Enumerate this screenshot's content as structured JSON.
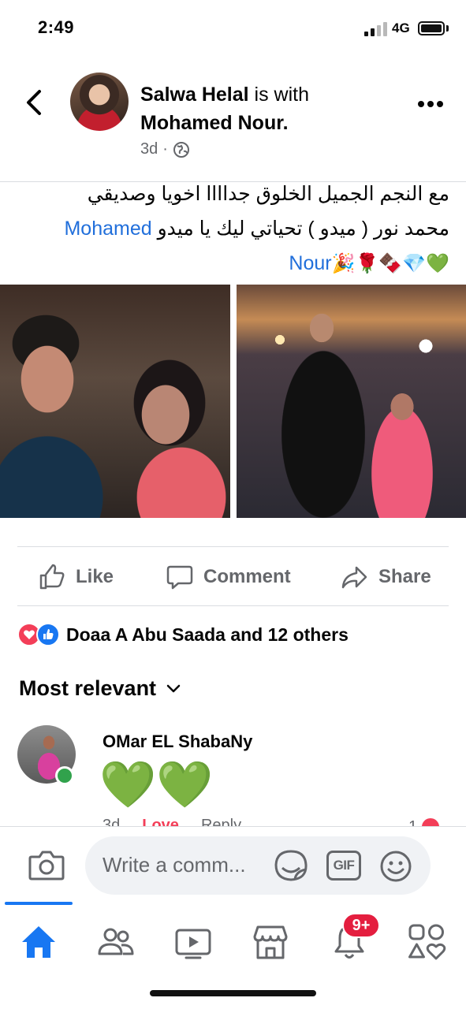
{
  "status_bar": {
    "time": "2:49",
    "network": "4G",
    "signal_bars_active": 2,
    "signal_bars_total": 4,
    "battery_level": 1.0
  },
  "post": {
    "author": "Salwa Helal",
    "with_text": " is with",
    "tagged": "Mohamed Nour.",
    "timestamp": "3d",
    "separator": "·",
    "privacy_icon": "globe-icon",
    "text_line1": "مع النجم الجميل الخلوق جداااا اخويا وصديقي",
    "text_line2_ar": "محمد نور ( ميدو ) تحياتي ليك يا ميدو",
    "text_mention_part1": "Mohamed",
    "text_mention_part2": "Nour",
    "emojis": "💚💎🍫🌹🎉"
  },
  "actions": {
    "like_label": "Like",
    "comment_label": "Comment",
    "share_label": "Share"
  },
  "reactions": {
    "summary": "Doaa A Abu Saada and 12 others",
    "icons": [
      "love-reaction-icon",
      "like-reaction-icon"
    ]
  },
  "comments": {
    "sort_label": "Most relevant",
    "items": [
      {
        "name": "OMar EL ShabaNy",
        "body": "💚💚",
        "time": "3d",
        "reaction_label": "Love",
        "reply_label": "Reply",
        "reaction_count": "1"
      }
    ]
  },
  "composer": {
    "placeholder": "Write a comm...",
    "gif_label": "GIF"
  },
  "tab_bar": {
    "tabs": [
      "home",
      "friends",
      "watch",
      "marketplace",
      "notifications",
      "menu"
    ],
    "notifications_badge": "9+"
  },
  "colors": {
    "brand": "#1877f2",
    "mention": "#216fdb",
    "love": "#f33e58",
    "badge": "#e41e3f",
    "secondary_text": "#65676b"
  }
}
